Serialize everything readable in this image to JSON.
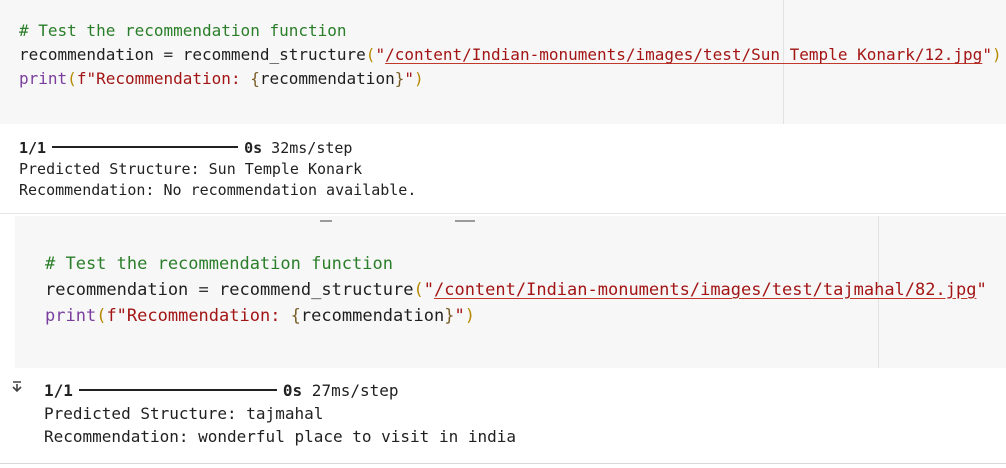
{
  "cell1": {
    "comment": "# Test the recommendation function",
    "line2": {
      "var": "recommendation",
      "eq": " = ",
      "fn": "recommend_structure",
      "open": "(",
      "str_q1": "\"",
      "path": "/content/Indian-monuments/images/test/Sun Temple Konark/12.jpg",
      "str_q2": "\"",
      "close": ")"
    },
    "line3": {
      "fn": "print",
      "open": "(",
      "fprefix": "f\"Recommendation: ",
      "brace_open": "{",
      "var": "recommendation",
      "brace_close": "}",
      "quote": "\"",
      "close": ")"
    }
  },
  "output1": {
    "progress": "1/1",
    "time_bold": "0s",
    "time_rest": " 32ms/step",
    "predicted": "Predicted Structure: Sun Temple Konark",
    "recommendation": "Recommendation: No recommendation available."
  },
  "cell2": {
    "comment": "# Test the recommendation function",
    "line2": {
      "var": "recommendation",
      "eq": " = ",
      "fn": "recommend_structure",
      "open": "(",
      "str_q1": "\"",
      "path": "/content/Indian-monuments/images/test/tajmahal/82.jpg",
      "str_q2": "\""
    },
    "line3": {
      "fn": "print",
      "open": "(",
      "fprefix": "f\"Recommendation: ",
      "brace_open": "{",
      "var": "recommendation",
      "brace_close": "}",
      "quote": "\"",
      "close": ")"
    }
  },
  "output2": {
    "progress": "1/1",
    "time_bold": "0s",
    "time_rest": " 27ms/step",
    "predicted": "Predicted Structure: tajmahal",
    "recommendation": "Recommendation: wonderful place to visit in india"
  }
}
